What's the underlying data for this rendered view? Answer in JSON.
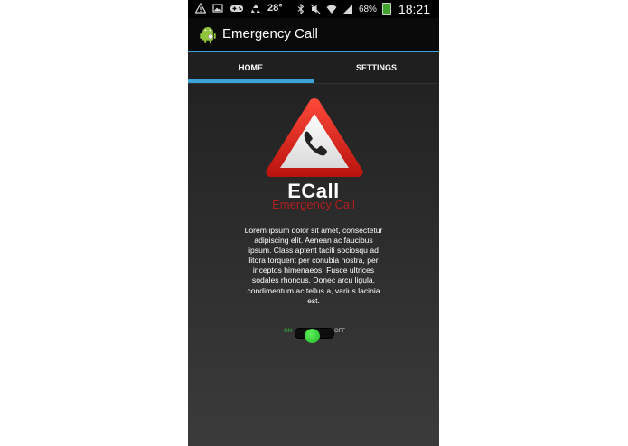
{
  "status_bar": {
    "temperature": "28°",
    "battery_percent": "68%",
    "time": "18:21",
    "icons": [
      "warning-icon",
      "gallery-icon",
      "gamepad-icon",
      "recycle-icon",
      "bluetooth-icon",
      "mute-icon",
      "wifi-icon",
      "signal-icon",
      "battery-icon"
    ]
  },
  "action_bar": {
    "title": "Emergency Call",
    "icon": "android-icon"
  },
  "tabs": [
    {
      "label": "HOME",
      "selected": true
    },
    {
      "label": "SETTINGS",
      "selected": false
    }
  ],
  "main": {
    "logo_icon": "phone-warning-icon",
    "logo_title": "ECall",
    "logo_subtitle": "Emergency Call",
    "description": "Lorem ipsum dolor sit amet, consectetur adipiscing elit. Aenean ac faucibus ipsum. Class aptent taciti sociosqu ad litora torquent per conubia nostra, per inceptos himenaeos. Fusce ultrices sodales rhoncus. Donec arcu ligula, condimentum ac tellus a, varius lacinia est.",
    "toggle": {
      "on_label": "ON",
      "off_label": "OFF",
      "state": "on"
    }
  },
  "colors": {
    "accent": "#3aa3d8",
    "toggle_on": "#34c13a",
    "logo_red": "#b01e1e"
  }
}
